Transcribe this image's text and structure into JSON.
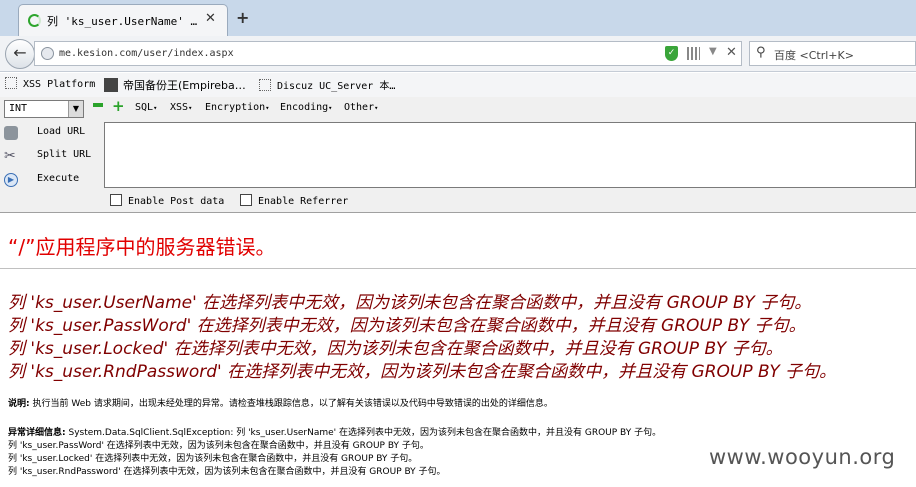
{
  "browser": {
    "tab_title": "列 'ks_user.UserName' 在选择列表中无效…",
    "tab_title_short": "列 'ks_user.UserName' …",
    "tab_close": "✕",
    "new_tab": "+",
    "url": "me.kesion.com/user/index.aspx",
    "search_placeholder": "百度 <Ctrl+K>",
    "stop": "✕",
    "back": "←"
  },
  "bookmarks": [
    {
      "label": "XSS Platform",
      "icon": "dotted-box-icon"
    },
    {
      "label": "帝国备份王(Empireba…",
      "icon": "favicon"
    },
    {
      "label": "Discuz UC_Server 本…",
      "icon": "dotted-box-icon"
    }
  ],
  "hackbar": {
    "select_value": "INT",
    "menus": [
      "SQL",
      "XSS",
      "Encryption",
      "Encoding",
      "Other"
    ],
    "actions": [
      "Load URL",
      "Split URL",
      "Execute"
    ],
    "checkboxes": [
      "Enable Post data",
      "Enable Referrer"
    ],
    "textarea_value": ""
  },
  "page": {
    "title": "“/”应用程序中的服务器错误。",
    "errors": [
      "列 'ks_user.UserName' 在选择列表中无效，因为该列未包含在聚合函数中，并且没有 GROUP BY 子句。",
      "列 'ks_user.PassWord' 在选择列表中无效，因为该列未包含在聚合函数中，并且没有 GROUP BY 子句。",
      "列 'ks_user.Locked' 在选择列表中无效，因为该列未包含在聚合函数中，并且没有 GROUP BY 子句。",
      "列 'ks_user.RndPassword' 在选择列表中无效，因为该列未包含在聚合函数中，并且没有 GROUP BY 子句。"
    ],
    "description_label": "说明:",
    "description_text": "执行当前 Web 请求期间，出现未经处理的异常。请检查堆栈跟踪信息，以了解有关该错误以及代码中导致错误的出处的详细信息。",
    "detail_label": "异常详细信息:",
    "detail_lines": [
      "System.Data.SqlClient.SqlException: 列 'ks_user.UserName' 在选择列表中无效，因为该列未包含在聚合函数中，并且没有 GROUP BY 子句。",
      "列 'ks_user.PassWord' 在选择列表中无效，因为该列未包含在聚合函数中，并且没有 GROUP BY 子句。",
      "列 'ks_user.Locked' 在选择列表中无效，因为该列未包含在聚合函数中，并且没有 GROUP BY 子句。",
      "列 'ks_user.RndPassword' 在选择列表中无效，因为该列未包含在聚合函数中，并且没有 GROUP BY 子句。"
    ]
  },
  "watermark": "www.wooyun.org",
  "colors": {
    "title_red": "#e10000",
    "error_maroon": "#800000",
    "hackbar_green": "#2ba32b"
  }
}
